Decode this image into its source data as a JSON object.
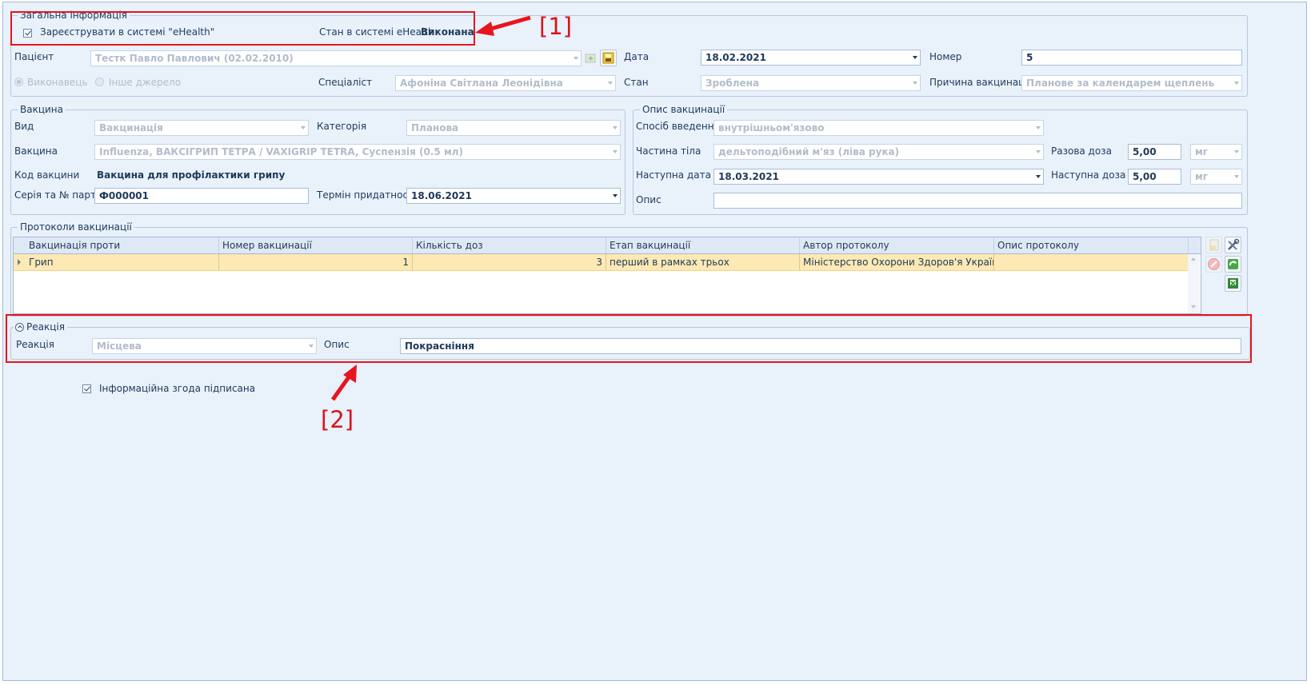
{
  "general": {
    "legend": "Загальна інформація",
    "register_label": "Зареєструвати в системі \"eHealth\"",
    "status_label": "Стан в системі eHealth",
    "status_value": "Виконана",
    "patient_label": "Пацієнт",
    "patient_value": "Тестк Павло Павлович (02.02.2010)",
    "date_label": "Дата",
    "date_value": "18.02.2021",
    "number_label": "Номер",
    "number_value": "5",
    "performer_label": "Виконавець",
    "other_source_label": "Інше джерело",
    "specialist_label": "Спеціаліст",
    "specialist_value": "Афоніна Світлана Леонідівна",
    "state_label": "Стан",
    "state_value": "Зроблена",
    "reason_label": "Причина вакцинації",
    "reason_value": "Планове за календарем щеплень"
  },
  "vaccine": {
    "legend": "Вакцина",
    "kind_label": "Вид",
    "kind_value": "Вакцинація",
    "category_label": "Категорія",
    "category_value": "Планова",
    "vaccine_label": "Вакцина",
    "vaccine_value": "Influenza, ВАКСІГРИП ТЕТРА / VAXIGRIP TETRA, Суспензія (0.5 мл)",
    "code_label": "Код вакцини",
    "code_value": "Вакцина для профілактики грипу",
    "series_label": "Серія та № партії",
    "series_value": "Ф000001",
    "expiry_label": "Термін придатності",
    "expiry_value": "18.06.2021"
  },
  "description": {
    "legend": "Опис вакцинації",
    "route_label": "Спосіб введення",
    "route_value": "внутрішньом'язово",
    "body_part_label": "Частина тіла",
    "body_part_value": "дельтоподібний м'яз (ліва рука)",
    "single_dose_label": "Разова доза",
    "single_dose_value": "5,00",
    "single_dose_unit": "мг",
    "next_date_label": "Наступна дата",
    "next_date_value": "18.03.2021",
    "next_dose_label": "Наступна доза",
    "next_dose_value": "5,00",
    "next_dose_unit": "мг",
    "desc_label": "Опис",
    "desc_value": ""
  },
  "protocols": {
    "legend": "Протоколи вакцинації",
    "columns": [
      "Вакцинація проти",
      "Номер вакцинації",
      "Кількість доз",
      "Етап вакцинації",
      "Автор протоколу",
      "Опис протоколу"
    ],
    "rows": [
      [
        "Грип",
        "1",
        "3",
        "перший в рамках трьох",
        "Міністерство Охорони Здоров'я України",
        ""
      ]
    ]
  },
  "reaction": {
    "legend": "Реакція",
    "reaction_label": "Реакція",
    "reaction_value": "Місцева",
    "desc_label": "Опис",
    "desc_value": "Покраснiння"
  },
  "consent_label": "Інформаційна згода підписана",
  "annotations": {
    "label1": "[1]",
    "label2": "[2]"
  },
  "colors": {
    "panel_bg": "#e9f1fb",
    "highlight_row": "#fde9b3",
    "annotation_red": "#e8141e",
    "text": "#1e395b"
  }
}
